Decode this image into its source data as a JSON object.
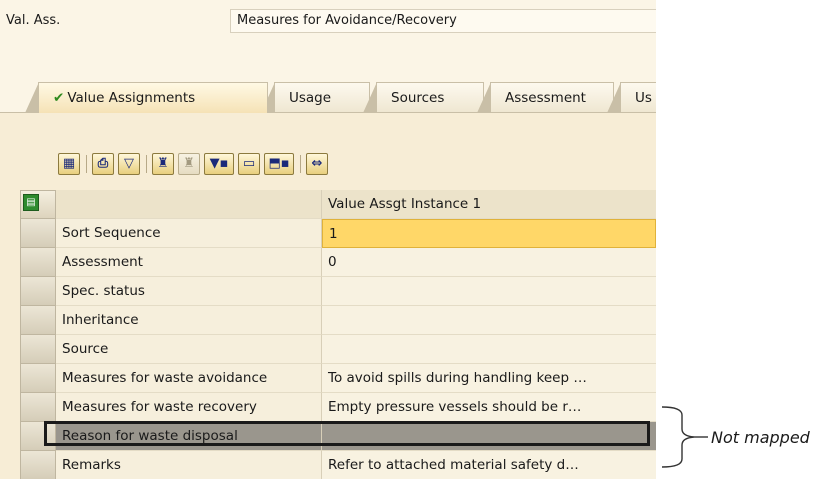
{
  "header": {
    "label": "Val. Ass.",
    "value": "Measures for Avoidance/Recovery"
  },
  "tabs": [
    {
      "label": "Value Assignments",
      "active": true,
      "check_icon": "checkmark-icon"
    },
    {
      "label": "Usage"
    },
    {
      "label": "Sources"
    },
    {
      "label": "Assessment"
    },
    {
      "label": "Us"
    }
  ],
  "toolbar": {
    "buttons": [
      "table-settings-icon",
      "print-icon",
      "filter-icon",
      "find-icon",
      "find-next-icon",
      "set-filter-icon",
      "print-preview-icon",
      "export-icon",
      "binoculars-goto-icon"
    ]
  },
  "grid": {
    "select_icon": "select-all-icon",
    "column_header": "Value Assgt Instance 1",
    "rows": [
      {
        "label": "Sort Sequence",
        "value": "1"
      },
      {
        "label": "Assessment",
        "value": "0"
      },
      {
        "label": "Spec. status",
        "value": ""
      },
      {
        "label": "Inheritance",
        "value": ""
      },
      {
        "label": "Source",
        "value": ""
      },
      {
        "label": "Measures for waste avoidance",
        "value": "To avoid spills during handling keep …"
      },
      {
        "label": "Measures for waste recovery",
        "value": "Empty pressure vessels should be r…"
      },
      {
        "label": "Reason for waste disposal",
        "value": ""
      },
      {
        "label": "Remarks",
        "value": "Refer to attached material safety d…"
      }
    ]
  },
  "annotation": {
    "text": "Not mapped"
  },
  "colors": {
    "focus": "#ffd768",
    "marked_row": "#9a968d",
    "tab_active": "#f5e2b6"
  }
}
